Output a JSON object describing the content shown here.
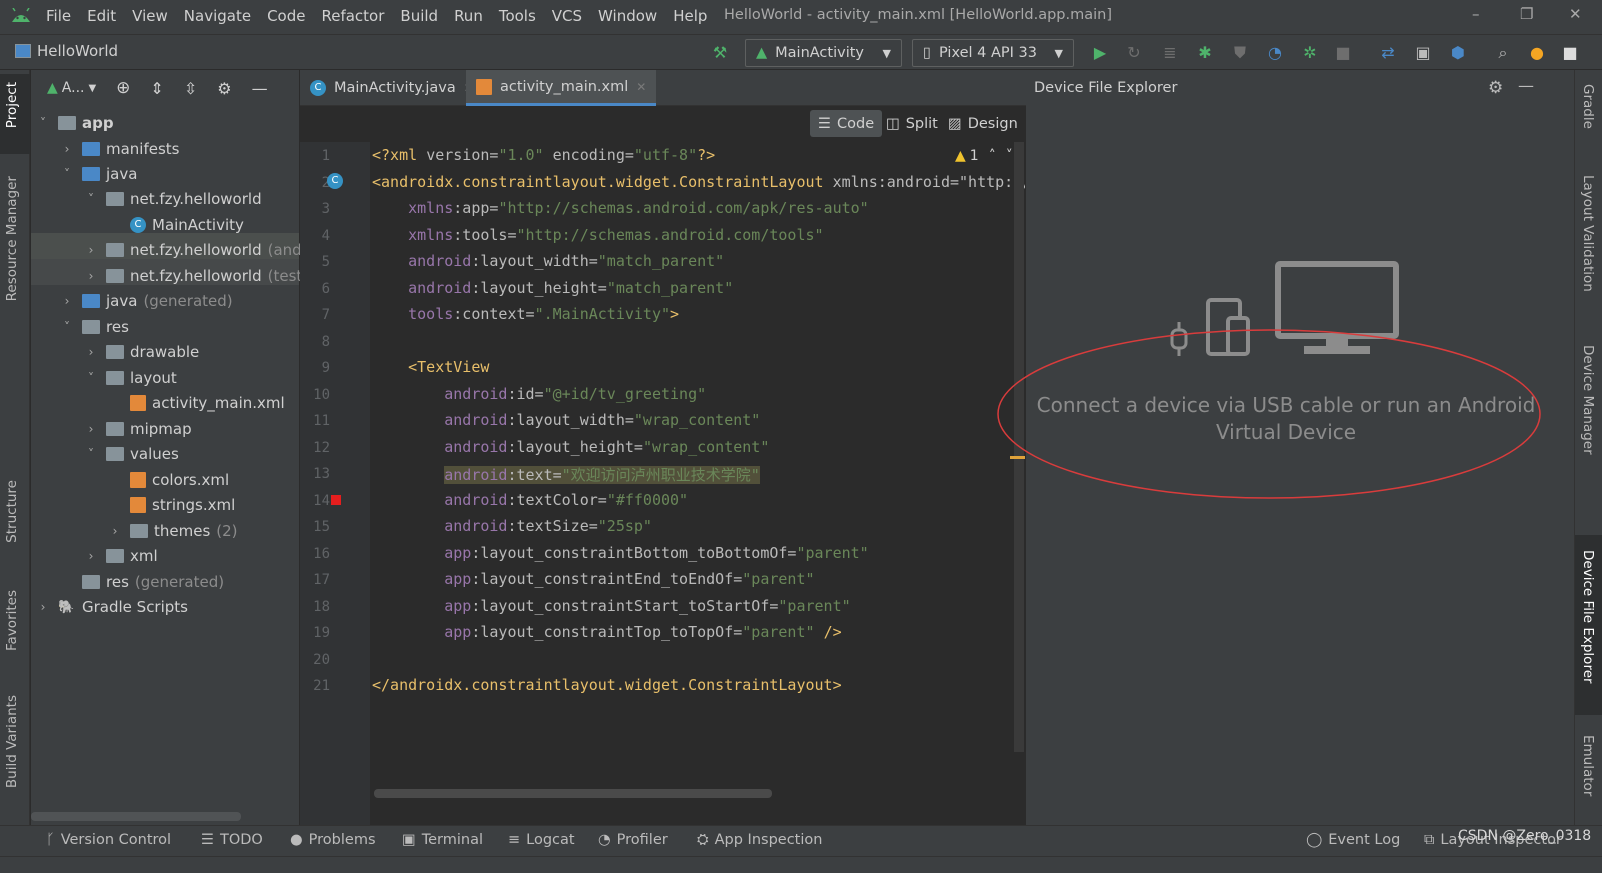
{
  "window": {
    "title": "HelloWorld - activity_main.xml [HelloWorld.app.main]"
  },
  "menu": {
    "items": [
      "File",
      "Edit",
      "View",
      "Navigate",
      "Code",
      "Refactor",
      "Build",
      "Run",
      "Tools",
      "VCS",
      "Window",
      "Help"
    ]
  },
  "toolbar": {
    "project_name": "HelloWorld",
    "run_config": "MainActivity",
    "device": "Pixel 4 API 33"
  },
  "left_strip": {
    "project": "Project",
    "resource_manager": "Resource Manager",
    "structure": "Structure",
    "favorites": "Favorites",
    "build_variants": "Build Variants"
  },
  "right_strip": {
    "gradle": "Gradle",
    "layout_validation": "Layout Validation",
    "device_manager": "Device Manager",
    "device_file_explorer": "Device File Explorer",
    "emulator": "Emulator"
  },
  "project_panel": {
    "selector": "A...",
    "tree": [
      {
        "label": "app",
        "suffix": ""
      },
      {
        "label": "manifests",
        "suffix": ""
      },
      {
        "label": "java",
        "suffix": ""
      },
      {
        "label": "net.fzy.helloworld",
        "suffix": ""
      },
      {
        "label": "MainActivity",
        "suffix": ""
      },
      {
        "label": "net.fzy.helloworld",
        "suffix": "(andro"
      },
      {
        "label": "net.fzy.helloworld",
        "suffix": "(test)"
      },
      {
        "label": "java",
        "suffix": "(generated)"
      },
      {
        "label": "res",
        "suffix": ""
      },
      {
        "label": "drawable",
        "suffix": ""
      },
      {
        "label": "layout",
        "suffix": ""
      },
      {
        "label": "activity_main.xml",
        "suffix": ""
      },
      {
        "label": "mipmap",
        "suffix": ""
      },
      {
        "label": "values",
        "suffix": ""
      },
      {
        "label": "colors.xml",
        "suffix": ""
      },
      {
        "label": "strings.xml",
        "suffix": ""
      },
      {
        "label": "themes",
        "suffix": "(2)"
      },
      {
        "label": "xml",
        "suffix": ""
      },
      {
        "label": "res",
        "suffix": "(generated)"
      },
      {
        "label": "Gradle Scripts",
        "suffix": ""
      }
    ]
  },
  "editor": {
    "tabs": [
      "MainActivity.java",
      "activity_main.xml"
    ],
    "view_modes": [
      "Code",
      "Split",
      "Design"
    ],
    "warning_count": "1",
    "line_numbers": [
      "1",
      "2",
      "3",
      "4",
      "5",
      "6",
      "7",
      "8",
      "9",
      "10",
      "11",
      "12",
      "13",
      "14",
      "15",
      "16",
      "17",
      "18",
      "19",
      "20",
      "21"
    ],
    "lines": [
      "<?xml version=\"1.0\" encoding=\"utf-8\"?>",
      "<androidx.constraintlayout.widget.ConstraintLayout xmlns:android=\"http://",
      "    xmlns:app=\"http://schemas.android.com/apk/res-auto\"",
      "    xmlns:tools=\"http://schemas.android.com/tools\"",
      "    android:layout_width=\"match_parent\"",
      "    android:layout_height=\"match_parent\"",
      "    tools:context=\".MainActivity\">",
      "",
      "    <TextView",
      "        android:id=\"@+id/tv_greeting\"",
      "        android:layout_width=\"wrap_content\"",
      "        android:layout_height=\"wrap_content\"",
      "        android:text=\"欢迎访问泸州职业技术学院\"",
      "        android:textColor=\"#ff0000\"",
      "        android:textSize=\"25sp\"",
      "        app:layout_constraintBottom_toBottomOf=\"parent\"",
      "        app:layout_constraintEnd_toEndOf=\"parent\"",
      "        app:layout_constraintStart_toStartOf=\"parent\"",
      "        app:layout_constraintTop_toTopOf=\"parent\" />",
      "",
      "</androidx.constraintlayout.widget.ConstraintLayout>"
    ]
  },
  "device_file_explorer": {
    "title": "Device File Explorer",
    "message_line1": "Connect a device via USB cable or run an Android",
    "message_line2": "Virtual Device"
  },
  "bottom_bar": {
    "version_control": "Version Control",
    "todo": "TODO",
    "problems": "Problems",
    "terminal": "Terminal",
    "logcat": "Logcat",
    "profiler": "Profiler",
    "app_inspection": "App Inspection",
    "event_log": "Event Log",
    "layout_inspector": "Layout Inspector",
    "watermark": "CSDN @Zero_0318"
  },
  "colors": {
    "accent": "#4a88c7",
    "run_green": "#4fb36b",
    "annotation_red": "#d93c3c",
    "error_marker": "#e51e1e"
  }
}
